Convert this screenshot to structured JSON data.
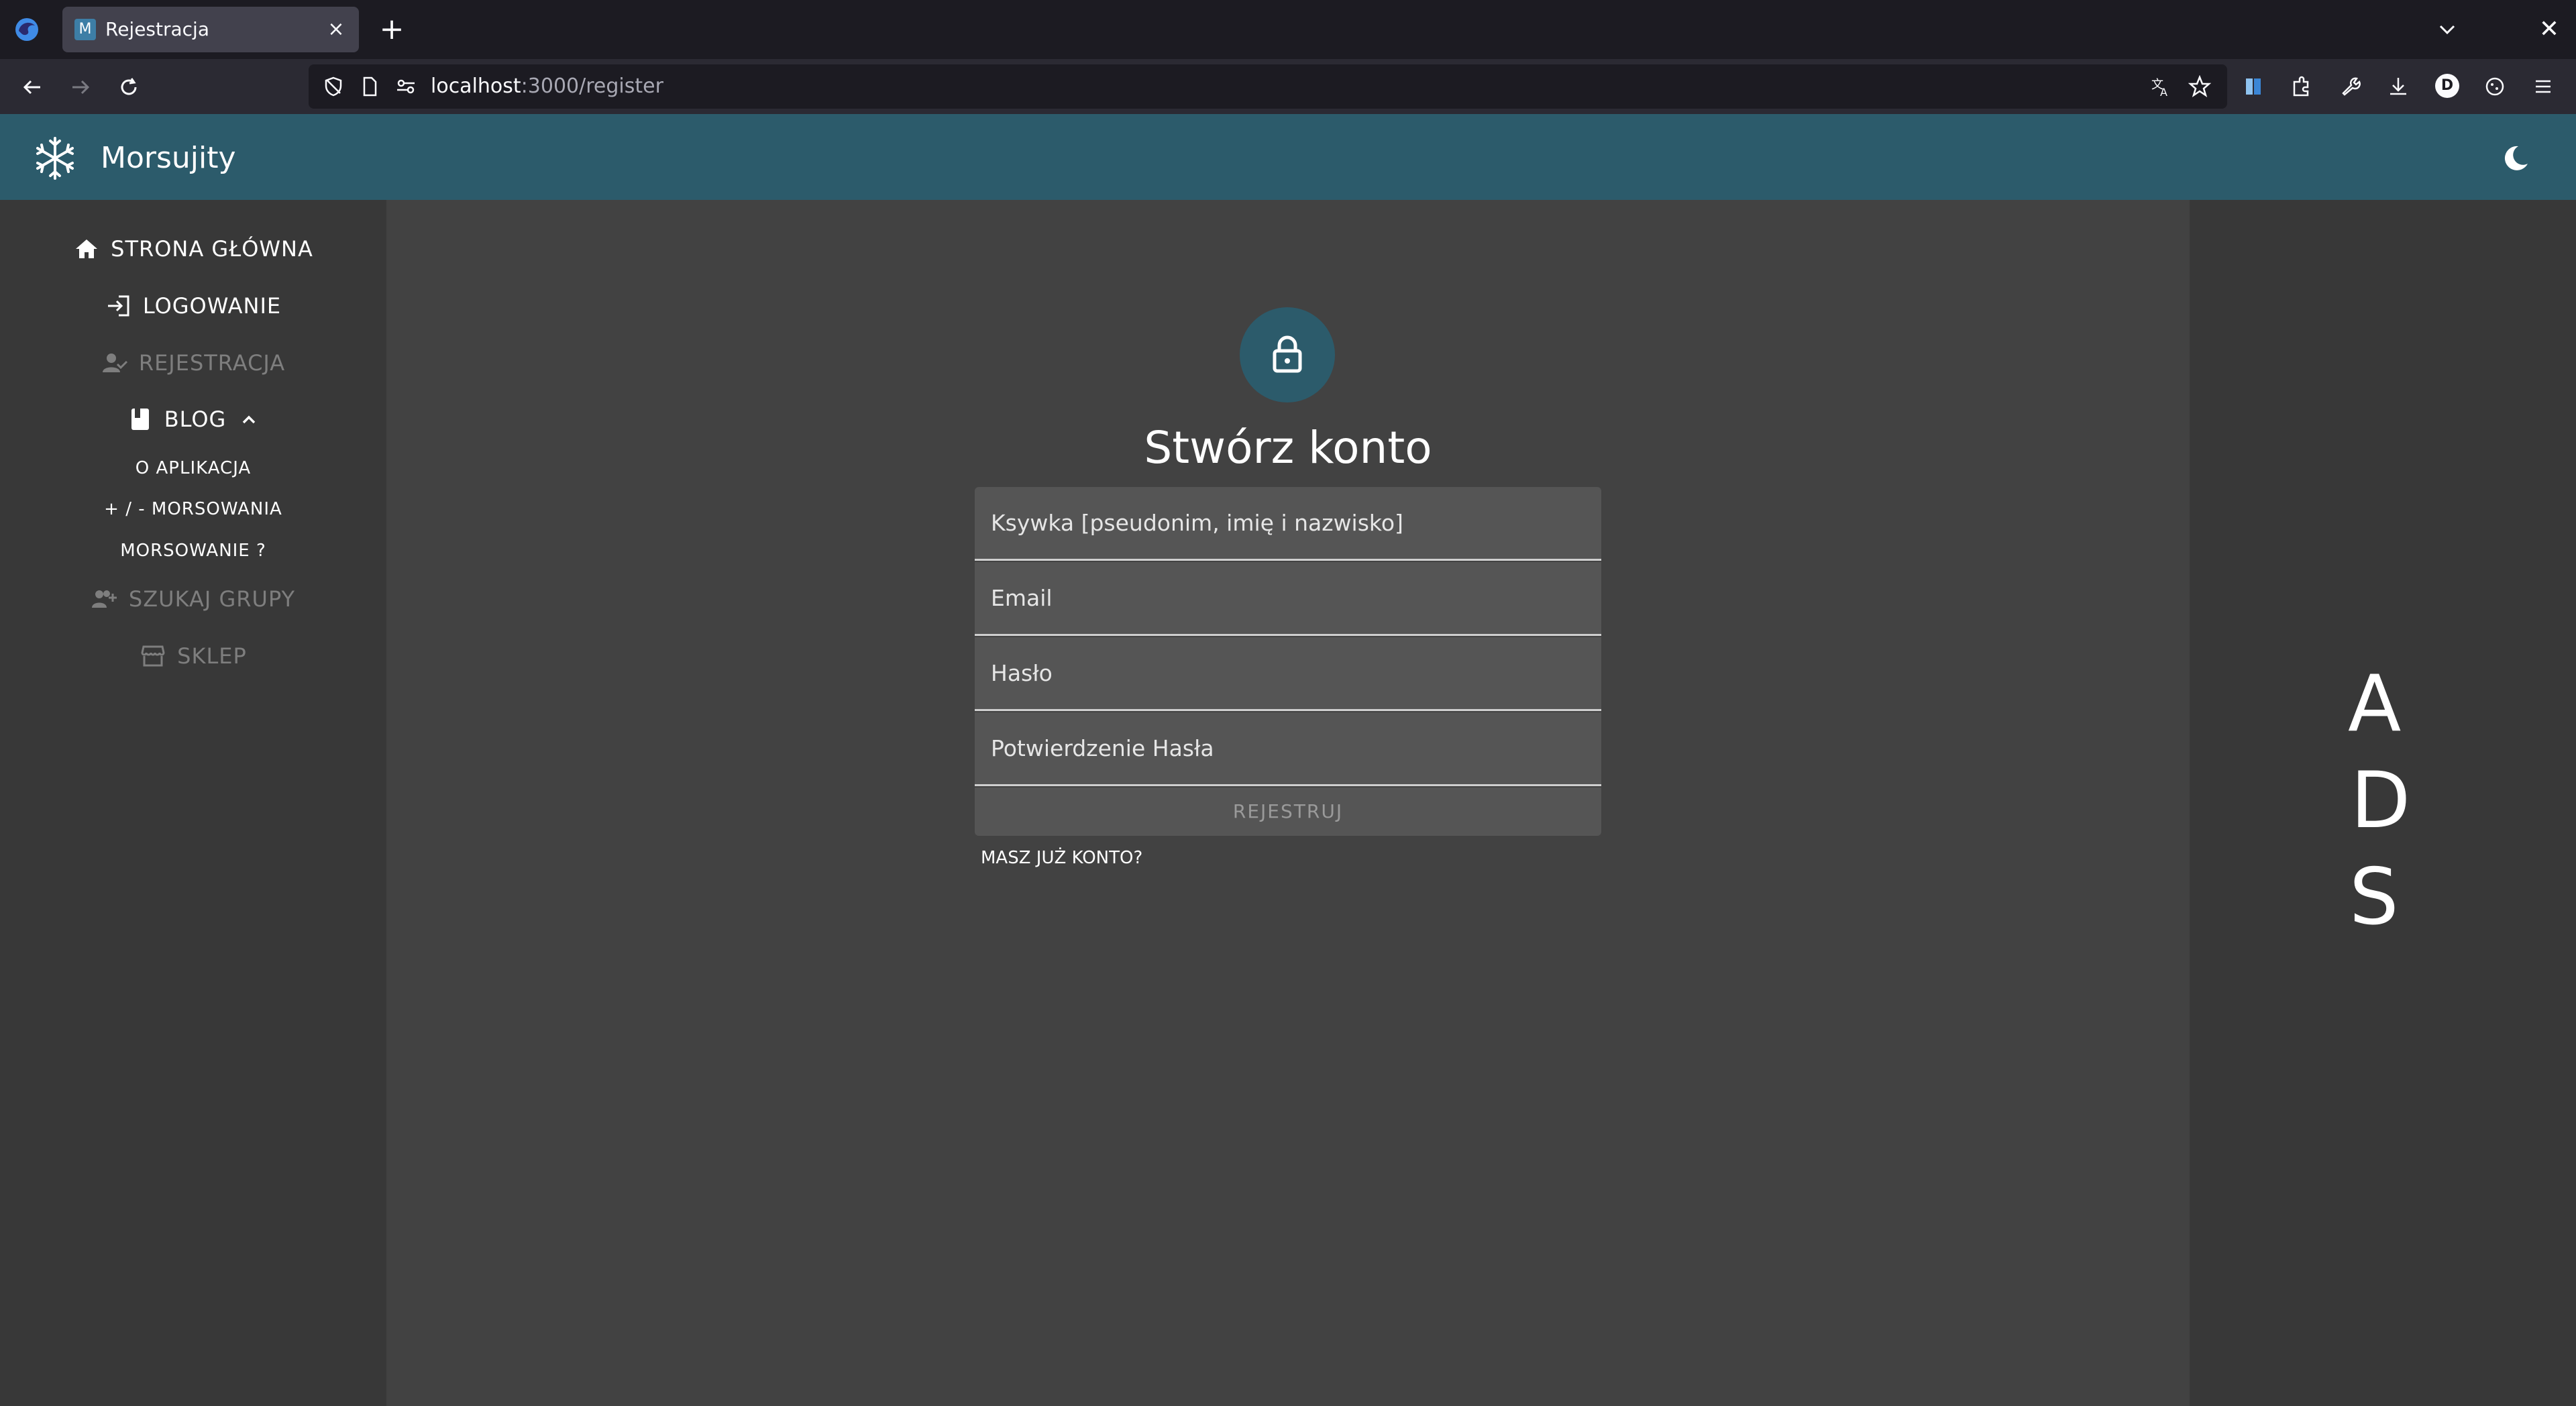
{
  "browser": {
    "tab_favicon_letter": "M",
    "tab_title": "Rejestracja",
    "url_host": "localhost",
    "url_path": ":3000/register",
    "profile_initial": "D"
  },
  "header": {
    "brand": "Morsujity"
  },
  "sidebar": {
    "items": [
      {
        "label": "STRONA GŁÓWNA",
        "icon": "home-icon"
      },
      {
        "label": "LOGOWANIE",
        "icon": "login-icon"
      },
      {
        "label": "REJESTRACJA",
        "icon": "user-check-icon",
        "disabled": true
      },
      {
        "label": "BLOG",
        "icon": "book-icon"
      },
      {
        "label": "SZUKAJ GRUPY",
        "icon": "group-add-icon",
        "disabled": true
      },
      {
        "label": "SKLEP",
        "icon": "store-icon",
        "disabled": true
      }
    ],
    "blog_sub": [
      "O APLIKACJA",
      "+ / - MORSOWANIA",
      "MORSOWANIE ?"
    ]
  },
  "form": {
    "title": "Stwórz konto",
    "nick_placeholder": "Ksywka [pseudonim, imię i nazwisko]",
    "email_placeholder": "Email",
    "password_placeholder": "Hasło",
    "confirm_placeholder": "Potwierdzenie Hasła",
    "submit_label": "REJESTRUJ",
    "login_link": "MASZ JUŻ KONTO?"
  },
  "ads": {
    "letters": [
      "A",
      "D",
      "S"
    ]
  },
  "colors": {
    "accent": "#2c5b6b",
    "background": "#424242",
    "sidebar": "#383838"
  }
}
